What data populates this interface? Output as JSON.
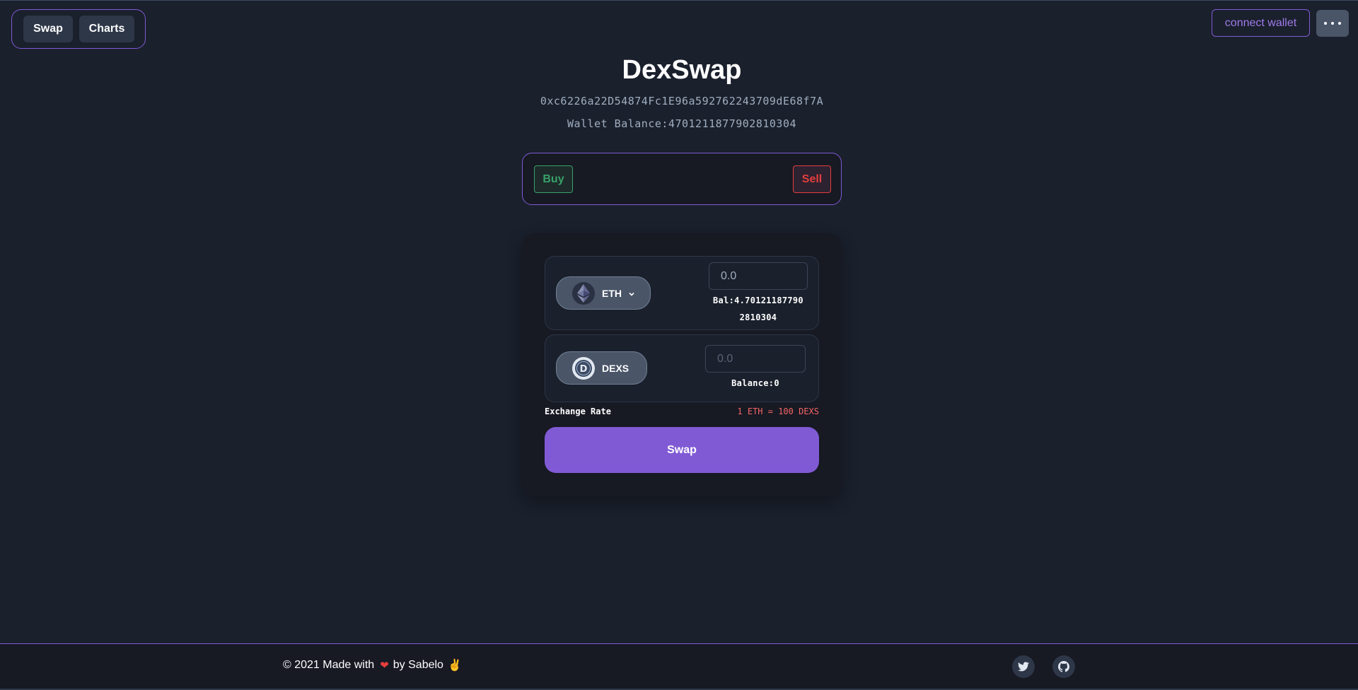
{
  "nav": {
    "swap_label": "Swap",
    "charts_label": "Charts",
    "connect_label": "connect wallet"
  },
  "header": {
    "title": "DexSwap",
    "address": "0xc6226a22D54874Fc1E96a592762243709dE68f7A",
    "wallet_balance": "Wallet Balance:4701211877902810304"
  },
  "trade": {
    "buy_label": "Buy",
    "sell_label": "Sell"
  },
  "swap": {
    "from": {
      "token": "ETH",
      "icon": "ethereum-icon",
      "placeholder": "0.0",
      "balance_line1": "Bal:4.70121187790",
      "balance_line2": "2810304"
    },
    "to": {
      "token": "DEXS",
      "icon": "dexs-token-icon",
      "placeholder": "0.0",
      "balance": "Balance:0"
    },
    "rate_label": "Exchange Rate",
    "rate_value": "1 ETH = 100 DEXS",
    "button_label": "Swap"
  },
  "footer": {
    "text_before": "© 2021 Made with",
    "text_after": "by Sabelo",
    "heart": "❤",
    "emoji": "✌",
    "social": [
      "twitter-icon",
      "github-icon"
    ]
  },
  "colors": {
    "background": "#1a202c",
    "accent": "#805ad5",
    "buy": "#38a169",
    "sell": "#e53e3e"
  }
}
